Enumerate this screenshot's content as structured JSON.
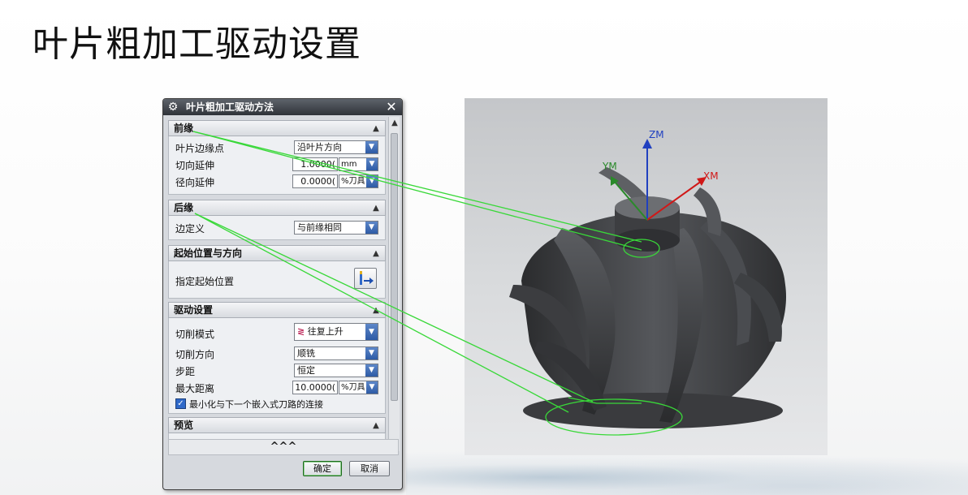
{
  "slide": {
    "title": "叶片粗加工驱动设置"
  },
  "dialog": {
    "title": "叶片粗加工驱动方法",
    "close_glyph": "✕",
    "gear_glyph": "⚙",
    "sections": {
      "leading_edge": {
        "header": "前缘",
        "rows": {
          "blade_edge_point": {
            "label": "叶片边缘点",
            "value": "沿叶片方向"
          },
          "tangential_extension": {
            "label": "切向延伸",
            "value": "1.0000(",
            "unit": "mm"
          },
          "radial_extension": {
            "label": "径向延伸",
            "value": "0.0000(",
            "unit": "%刀具"
          }
        }
      },
      "trailing_edge": {
        "header": "后缘",
        "rows": {
          "edge_definition": {
            "label": "边定义",
            "value": "与前缘相同"
          }
        }
      },
      "start_position": {
        "header": "起始位置与方向",
        "rows": {
          "specify_start": {
            "label": "指定起始位置"
          }
        }
      },
      "drive_settings": {
        "header": "驱动设置",
        "rows": {
          "cut_pattern": {
            "label": "切削模式",
            "value": "往复上升"
          },
          "cut_direction": {
            "label": "切削方向",
            "value": "顺铣"
          },
          "stepover": {
            "label": "步距",
            "value": "恒定"
          },
          "max_distance": {
            "label": "最大距离",
            "value": "10.0000(",
            "unit": "%刀具"
          },
          "minimize_checkbox": {
            "label": "最小化与下一个嵌入式刀路的连接",
            "checked": true
          }
        }
      },
      "preview": {
        "header": "预览"
      }
    },
    "expander": "^^^",
    "buttons": {
      "ok": "确定",
      "cancel": "取消"
    }
  },
  "viewport": {
    "axes": {
      "zm": "ZM",
      "ym": "YM",
      "xm": "XM"
    },
    "colors": {
      "zm": "#2040c0",
      "ym": "#2a8a2a",
      "xm": "#d01818",
      "leader_lines": "#39d839"
    }
  }
}
